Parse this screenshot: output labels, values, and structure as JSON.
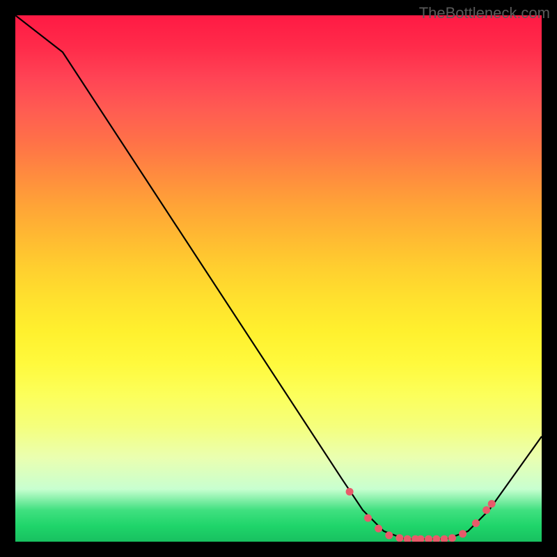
{
  "watermark": "TheBottleneck.com",
  "chart_data": {
    "type": "line",
    "title": "",
    "xlabel": "",
    "ylabel": "",
    "xlim": [
      0,
      100
    ],
    "ylim": [
      0,
      100
    ],
    "curve": [
      {
        "x": 0,
        "y": 100
      },
      {
        "x": 9,
        "y": 93
      },
      {
        "x": 62,
        "y": 12
      },
      {
        "x": 66,
        "y": 6
      },
      {
        "x": 70,
        "y": 2
      },
      {
        "x": 74,
        "y": 0.5
      },
      {
        "x": 82,
        "y": 0.5
      },
      {
        "x": 86,
        "y": 2
      },
      {
        "x": 90,
        "y": 6
      },
      {
        "x": 100,
        "y": 20
      }
    ],
    "marker_points": [
      {
        "x": 63.5,
        "y": 9.5
      },
      {
        "x": 67,
        "y": 4.5
      },
      {
        "x": 69,
        "y": 2.5
      },
      {
        "x": 71,
        "y": 1.2
      },
      {
        "x": 73,
        "y": 0.7
      },
      {
        "x": 74.5,
        "y": 0.5
      },
      {
        "x": 76,
        "y": 0.5
      },
      {
        "x": 77,
        "y": 0.5
      },
      {
        "x": 78.5,
        "y": 0.5
      },
      {
        "x": 80,
        "y": 0.5
      },
      {
        "x": 81.5,
        "y": 0.5
      },
      {
        "x": 83,
        "y": 0.7
      },
      {
        "x": 85,
        "y": 1.5
      },
      {
        "x": 87.5,
        "y": 3.5
      },
      {
        "x": 89.5,
        "y": 6
      },
      {
        "x": 90.5,
        "y": 7.2
      }
    ],
    "gradient_note": "background encodes bottleneck severity: red=high, green=low"
  }
}
